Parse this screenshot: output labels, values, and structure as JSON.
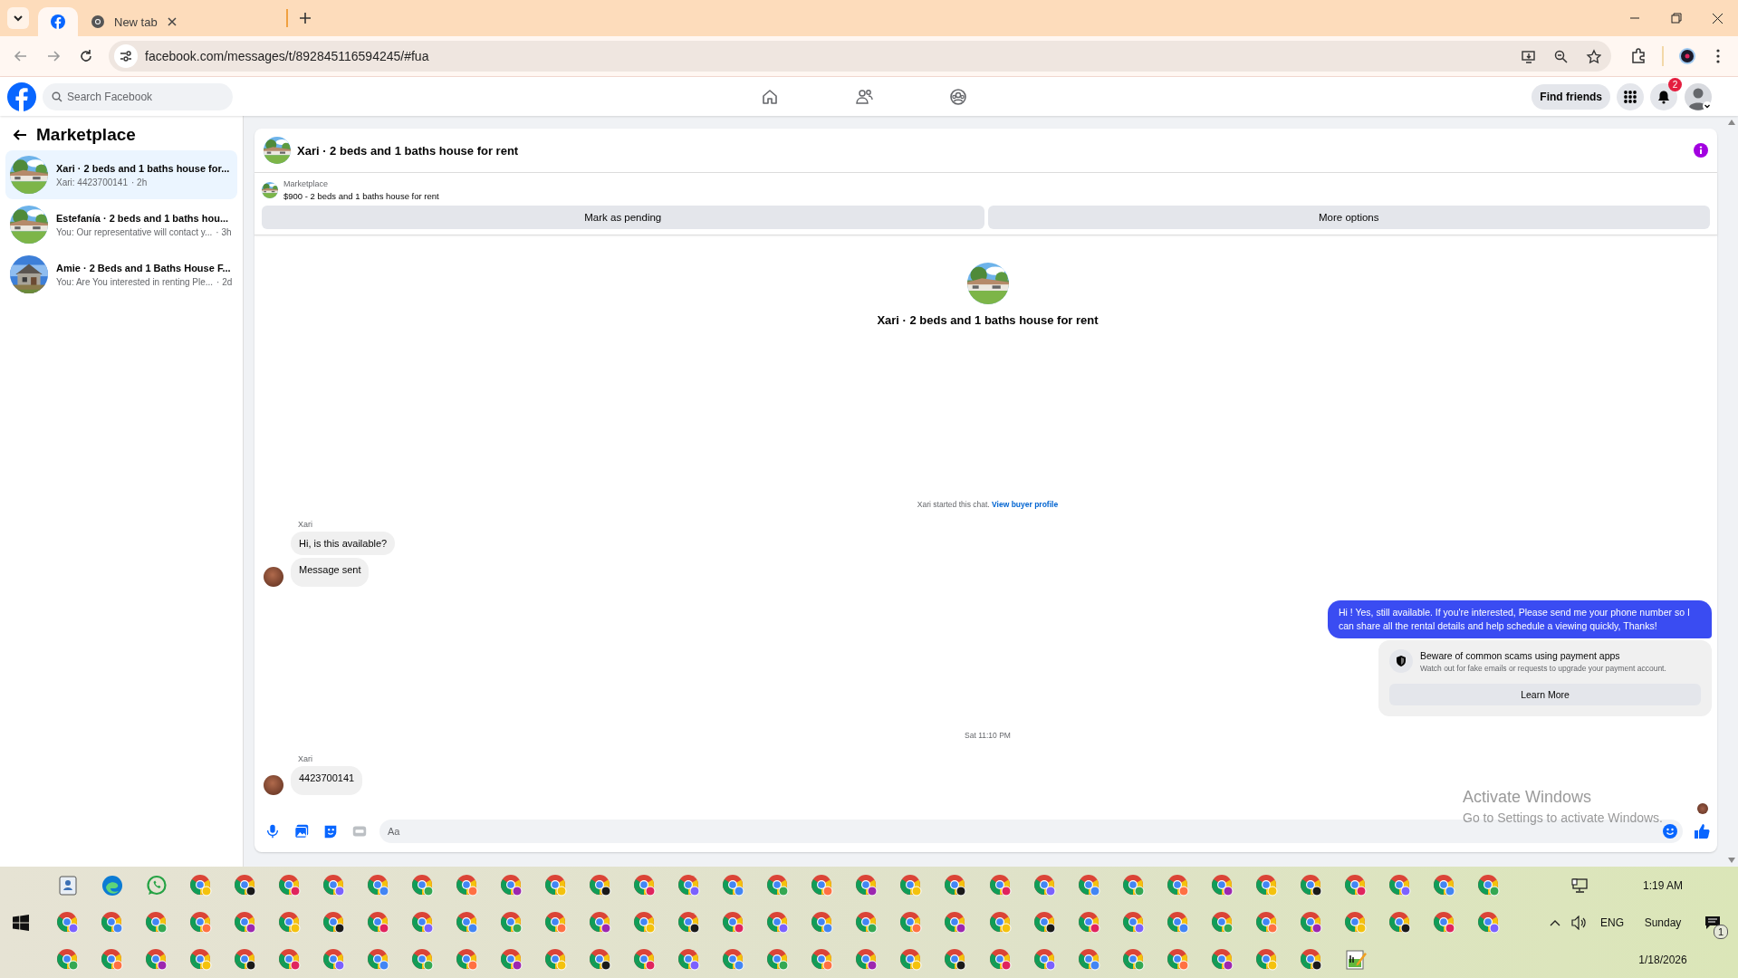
{
  "browser": {
    "tabs": [
      {
        "kind": "facebook",
        "selected": true
      },
      {
        "kind": "globe",
        "title": "New tab",
        "selected": false
      }
    ],
    "url": "facebook.com/messages/t/892845116594245/#fua"
  },
  "header": {
    "search_placeholder": "Search Facebook",
    "find_friends": "Find friends",
    "notification_count": "2"
  },
  "sidebar": {
    "title": "Marketplace",
    "items": [
      {
        "title": "Xari · 2 beds and 1 baths house for...",
        "preview": "Xari: 4423700141",
        "time": "· 2h",
        "selected": true
      },
      {
        "title": "Estefanía · 2 beds and 1 baths hou...",
        "preview": "You: Our representative will contact y...",
        "time": "· 3h",
        "selected": false
      },
      {
        "title": "Amie · 2 Beds and 1 Baths House F...",
        "preview": "You: Are You interested in renting Ple...",
        "time": "· 2d",
        "selected": false
      }
    ]
  },
  "chat": {
    "title": "Xari · 2 beds and 1 baths house for rent",
    "listing": {
      "source": "Marketplace",
      "summary": "$900 - 2 beds and 1 baths house for rent"
    },
    "actions": [
      "Mark as pending",
      "More options"
    ],
    "hero_title": "Xari · 2 beds and 1 baths house for rent",
    "messages": [
      {
        "kind": "system",
        "text": "Xari started this chat.",
        "link": "View buyer profile"
      },
      {
        "kind": "sender",
        "text": "Xari"
      },
      {
        "kind": "incoming",
        "text": "Hi, is this available?",
        "avatar": false
      },
      {
        "kind": "incoming",
        "text": "Message sent",
        "avatar": true
      },
      {
        "kind": "outgoing",
        "text": "Hi ! Yes, still available. If you're interested, Please send me your phone number so I can share all the rental details and help schedule a viewing quickly, Thanks!"
      },
      {
        "kind": "notice",
        "title": "Beware of common scams using payment apps",
        "body": "Watch out for fake emails or requests to upgrade your payment account.",
        "button": "Learn More"
      },
      {
        "kind": "timestamp",
        "text": "Sat 11:10 PM"
      },
      {
        "kind": "sender",
        "text": "Xari"
      },
      {
        "kind": "incoming",
        "text": "4423700141",
        "avatar": true
      }
    ],
    "composer": {
      "placeholder": "Aa"
    }
  },
  "activation_notice": {
    "title": "Activate Windows",
    "subtitle": "Go to Settings to activate Windows."
  },
  "taskbar": {
    "language": "ENG",
    "time": "1:19 AM",
    "day": "Sunday",
    "date": "1/18/2026",
    "notification_count": "1"
  }
}
